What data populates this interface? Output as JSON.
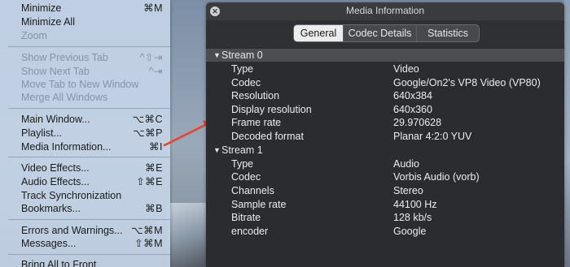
{
  "menu": {
    "items": [
      {
        "label": "Minimize",
        "shortcut": "⌘M",
        "disabled": false
      },
      {
        "label": "Minimize All",
        "shortcut": "",
        "disabled": false
      },
      {
        "label": "Zoom",
        "shortcut": "",
        "disabled": true
      },
      {
        "label": "Show Previous Tab",
        "shortcut": "^⇧⇥",
        "disabled": true
      },
      {
        "label": "Show Next Tab",
        "shortcut": "^⇥",
        "disabled": true
      },
      {
        "label": "Move Tab to New Window",
        "shortcut": "",
        "disabled": true
      },
      {
        "label": "Merge All Windows",
        "shortcut": "",
        "disabled": true
      },
      {
        "label": "Main Window...",
        "shortcut": "⌥⌘C",
        "disabled": false
      },
      {
        "label": "Playlist...",
        "shortcut": "⌥⌘P",
        "disabled": false
      },
      {
        "label": "Media Information...",
        "shortcut": "⌘I",
        "disabled": false
      },
      {
        "label": "Video Effects...",
        "shortcut": "⌘E",
        "disabled": false
      },
      {
        "label": "Audio Effects...",
        "shortcut": "⇧⌘E",
        "disabled": false
      },
      {
        "label": "Track Synchronization",
        "shortcut": "",
        "disabled": false
      },
      {
        "label": "Bookmarks...",
        "shortcut": "⌘B",
        "disabled": false
      },
      {
        "label": "Errors and Warnings...",
        "shortcut": "⌥⌘M",
        "disabled": false
      },
      {
        "label": "Messages...",
        "shortcut": "⇧⌘M",
        "disabled": false
      },
      {
        "label": "Bring All to Front",
        "shortcut": "",
        "disabled": false
      }
    ]
  },
  "window": {
    "title": "Media Information",
    "tabs": [
      {
        "label": "General",
        "active": true
      },
      {
        "label": "Codec Details",
        "active": false
      },
      {
        "label": "Statistics",
        "active": false
      }
    ]
  },
  "streams": [
    {
      "name": "Stream 0",
      "selected": true,
      "props": [
        {
          "key": "Type",
          "value": "Video"
        },
        {
          "key": "Codec",
          "value": "Google/On2's VP8 Video (VP80)"
        },
        {
          "key": "Resolution",
          "value": "640x384"
        },
        {
          "key": "Display resolution",
          "value": "640x360"
        },
        {
          "key": "Frame rate",
          "value": "29.970628"
        },
        {
          "key": "Decoded format",
          "value": "Planar 4:2:0 YUV"
        }
      ]
    },
    {
      "name": "Stream 1",
      "selected": false,
      "props": [
        {
          "key": "Type",
          "value": "Audio"
        },
        {
          "key": "Codec",
          "value": "Vorbis Audio (vorb)"
        },
        {
          "key": "Channels",
          "value": "Stereo"
        },
        {
          "key": "Sample rate",
          "value": "44100 Hz"
        },
        {
          "key": "Bitrate",
          "value": "128 kb/s"
        },
        {
          "key": "encoder",
          "value": "Google"
        }
      ]
    }
  ],
  "icons": {
    "close": "close-icon",
    "disclosure": "disclosure-triangle-icon"
  },
  "colors": {
    "annotation_arrow": "#e8432a",
    "menu_bg": "#c4d3e6",
    "panel_bg": "#2b2c2f"
  }
}
